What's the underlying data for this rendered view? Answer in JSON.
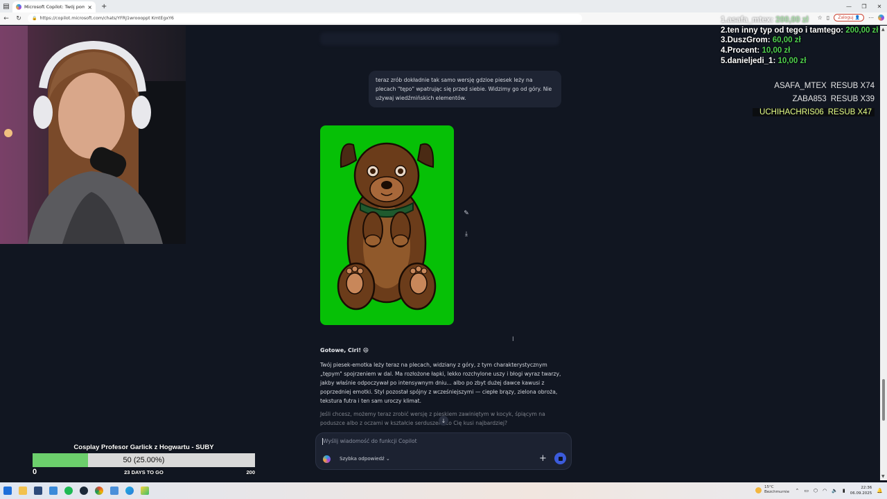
{
  "browser": {
    "tab_title": "Microsoft Copilot: Twój pomocni...",
    "url": "https://copilot.microsoft.com/chats/YFRJ1wroooppt KmtEgxY6",
    "login_label": "Zaloguj",
    "profile_initial": "C"
  },
  "chat": {
    "user_message": "teraz zrób dokładnie tak samo wersję gdzioe piesek leży na plecach \"tępo\" wpatrując się przed siebie. Widzimy go od góry. Nie używaj wiedźmińskich elementów.",
    "reply_heading": "Gotowe, Ciri! 😄",
    "reply_p1": "Twój piesek-emotka leży teraz na plecach, widziany z góry, z tym charakterystycznym „tępym\" spojrzeniem w dal. Ma rozłożone łapki, lekko rozchylone uszy i błogi wyraz twarzy, jakby właśnie odpoczywał po intensywnym dniu... albo po zbyt dużej dawce kawusi z poprzedniej emotki. Styl pozostał spójny z wcześniejszymi — ciepłe brązy, zielona obroża, tekstura futra i ten sam uroczy klimat.",
    "reply_p2": "Jeśli chcesz, możemy teraz zrobić wersję z pieskiem zawiniętym w kocyk, śpiącym na poduszce albo z oczami w kształcie serduszek. Co Cię kusi najbardziej?",
    "composer_placeholder": "Wyślij wiadomość do funkcji Copilot",
    "mode_label": "Szybka odpowiedź"
  },
  "leaderboard": [
    {
      "rank": "1.",
      "name": "asafa_mtex",
      "amount": "200,00 zł"
    },
    {
      "rank": "2.",
      "name": "ten inny typ od tego i tamtego",
      "amount": "200,00 zł"
    },
    {
      "rank": "3.",
      "name": "DuszGrom",
      "amount": "60,00 zł"
    },
    {
      "rank": "4.",
      "name": "Procent",
      "amount": "10,00 zł"
    },
    {
      "rank": "5.",
      "name": "danieljedi_1",
      "amount": "10,00 zł"
    }
  ],
  "resubs": [
    {
      "user": "ASAFA_MTEX",
      "label": "RESUB X74"
    },
    {
      "user": "ZABA853",
      "label": "RESUB X39"
    },
    {
      "user": "UCHIHACHRIS06",
      "label": "RESUB X47"
    }
  ],
  "goal": {
    "title": "Cosplay Profesor Garlick z Hogwartu - SUBY",
    "progress_text": "50 (25.00%)",
    "progress_fraction": 0.25,
    "min": "0",
    "days_left": "23 DAYS TO GO",
    "max": "200"
  },
  "taskbar": {
    "weather_temp": "15°C",
    "weather_desc": "Bezchmurnie",
    "time": "22:36",
    "date": "06.09.2025"
  },
  "colors": {
    "page_bg": "#111621",
    "image_bg": "#06c006",
    "goal_fill": "#6ccf6c",
    "amount_green": "#4fcf4f"
  }
}
